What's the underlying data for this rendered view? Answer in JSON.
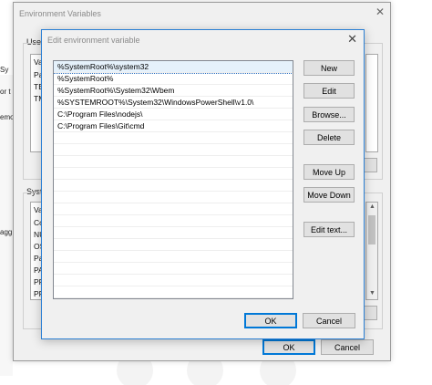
{
  "background_window": {
    "title": "Environment Variables",
    "user_group_label": "User",
    "user_list": {
      "header": "Va",
      "rows": [
        "Pa",
        "TE",
        "TM"
      ]
    },
    "system_group_label": "Syste",
    "system_list": {
      "header": "Va",
      "rows": [
        "Co",
        "NU",
        "OS",
        "Pa",
        "PA",
        "PR",
        "PR"
      ]
    },
    "ok_label": "OK",
    "cancel_label": "Cancel"
  },
  "left_fragment": {
    "labels": [
      "Sy",
      "or t",
      "emor",
      "agg"
    ]
  },
  "dialog": {
    "title": "Edit environment variable",
    "paths": [
      "%SystemRoot%\\system32",
      "%SystemRoot%",
      "%SystemRoot%\\System32\\Wbem",
      "%SYSTEMROOT%\\System32\\WindowsPowerShell\\v1.0\\",
      "C:\\Program Files\\nodejs\\",
      "C:\\Program Files\\Git\\cmd"
    ],
    "selected_index": 0,
    "buttons": {
      "new": "New",
      "edit": "Edit",
      "browse": "Browse...",
      "delete": "Delete",
      "move_up": "Move Up",
      "move_down": "Move Down",
      "edit_text": "Edit text..."
    },
    "ok_label": "OK",
    "cancel_label": "Cancel"
  },
  "colors": {
    "accent": "#0078d7",
    "selection": "#e5f1fb"
  }
}
